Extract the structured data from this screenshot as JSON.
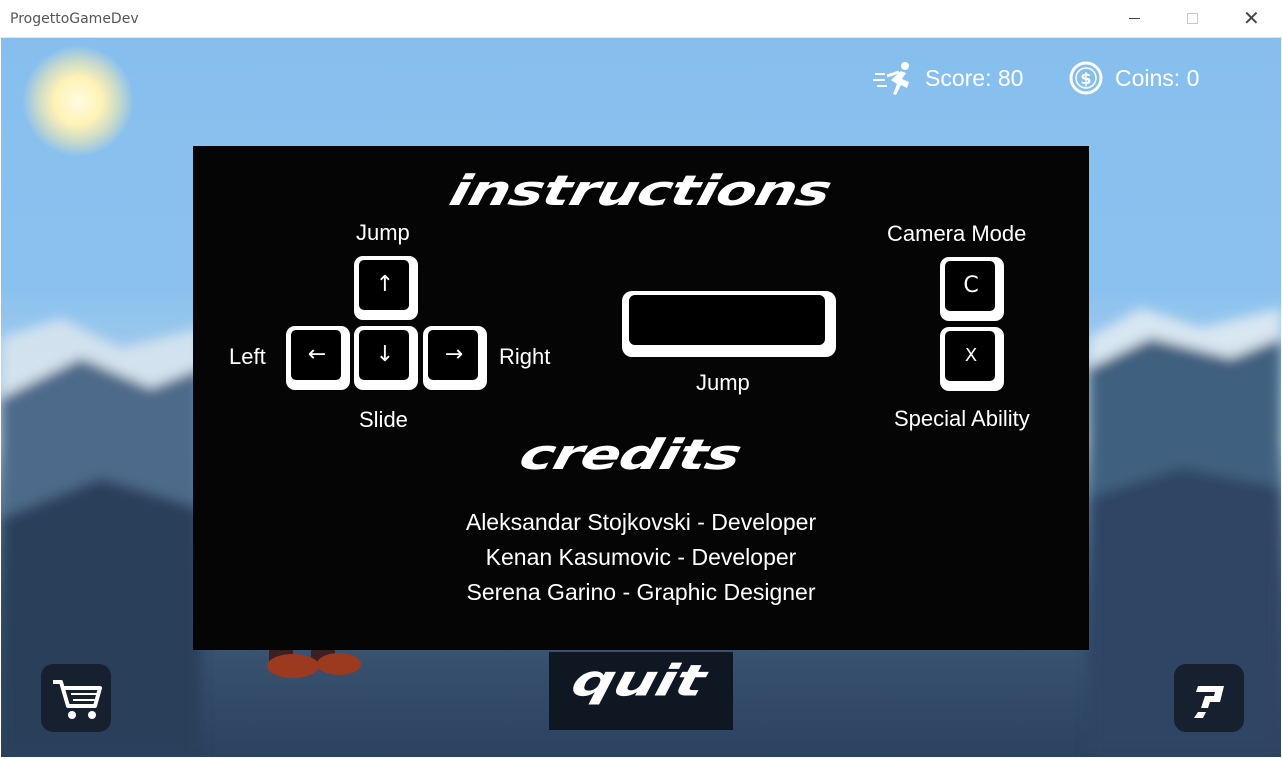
{
  "window": {
    "title": "ProgettoGameDev"
  },
  "hud": {
    "score_text": "Score: 80",
    "coins_text": "Coins: 0",
    "score_icon": "running-man-icon",
    "coins_icon": "dollar-coin-icon"
  },
  "instructions": {
    "heading": "instructions",
    "jump_label": "Jump",
    "left_label": "Left",
    "right_label": "Right",
    "slide_label": "Slide",
    "space_jump_label": "Jump",
    "camera_label": "Camera Mode",
    "special_label": "Special Ability",
    "keys": {
      "up": "↑",
      "down": "↓",
      "left": "←",
      "right": "→",
      "camera": "C",
      "special": "X"
    }
  },
  "credits": {
    "heading": "credits",
    "lines": [
      "Aleksandar Stojkovski - Developer",
      "Kenan Kasumovic - Developer",
      "Serena Garino - Graphic Designer"
    ]
  },
  "buttons": {
    "quit_label": "quit",
    "shop_icon": "shopping-cart-icon",
    "help_icon": "question-mark-icon"
  },
  "colors": {
    "panel": "#050505",
    "sky": "#86bfee",
    "button_bg": "#16202e",
    "text": "#ffffff"
  }
}
